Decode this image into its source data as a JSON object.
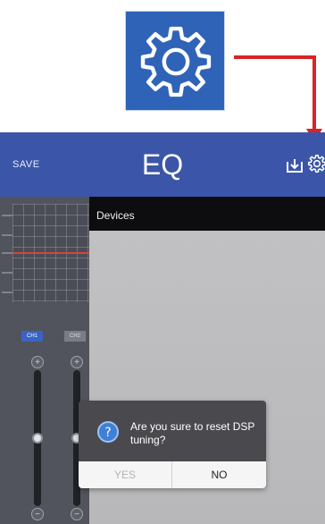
{
  "callout": {
    "icon": "gear-icon",
    "background_color": "#2f63b8",
    "arrow_color": "#d82424"
  },
  "app": {
    "header": {
      "save_label": "SAVE",
      "title": "EQ",
      "import_icon": "import-icon",
      "settings_icon": "gear-icon",
      "color": "#3b56a8"
    },
    "eq_panel": {
      "channels": [
        "CH1",
        "CH2"
      ],
      "active_channel": "CH1",
      "curve_color": "#d8433b"
    },
    "devices": {
      "title": "Devices"
    },
    "dialog": {
      "message": "Are you sure to reset DSP tuning?",
      "icon": "help-icon",
      "yes_label": "YES",
      "no_label": "NO"
    }
  }
}
